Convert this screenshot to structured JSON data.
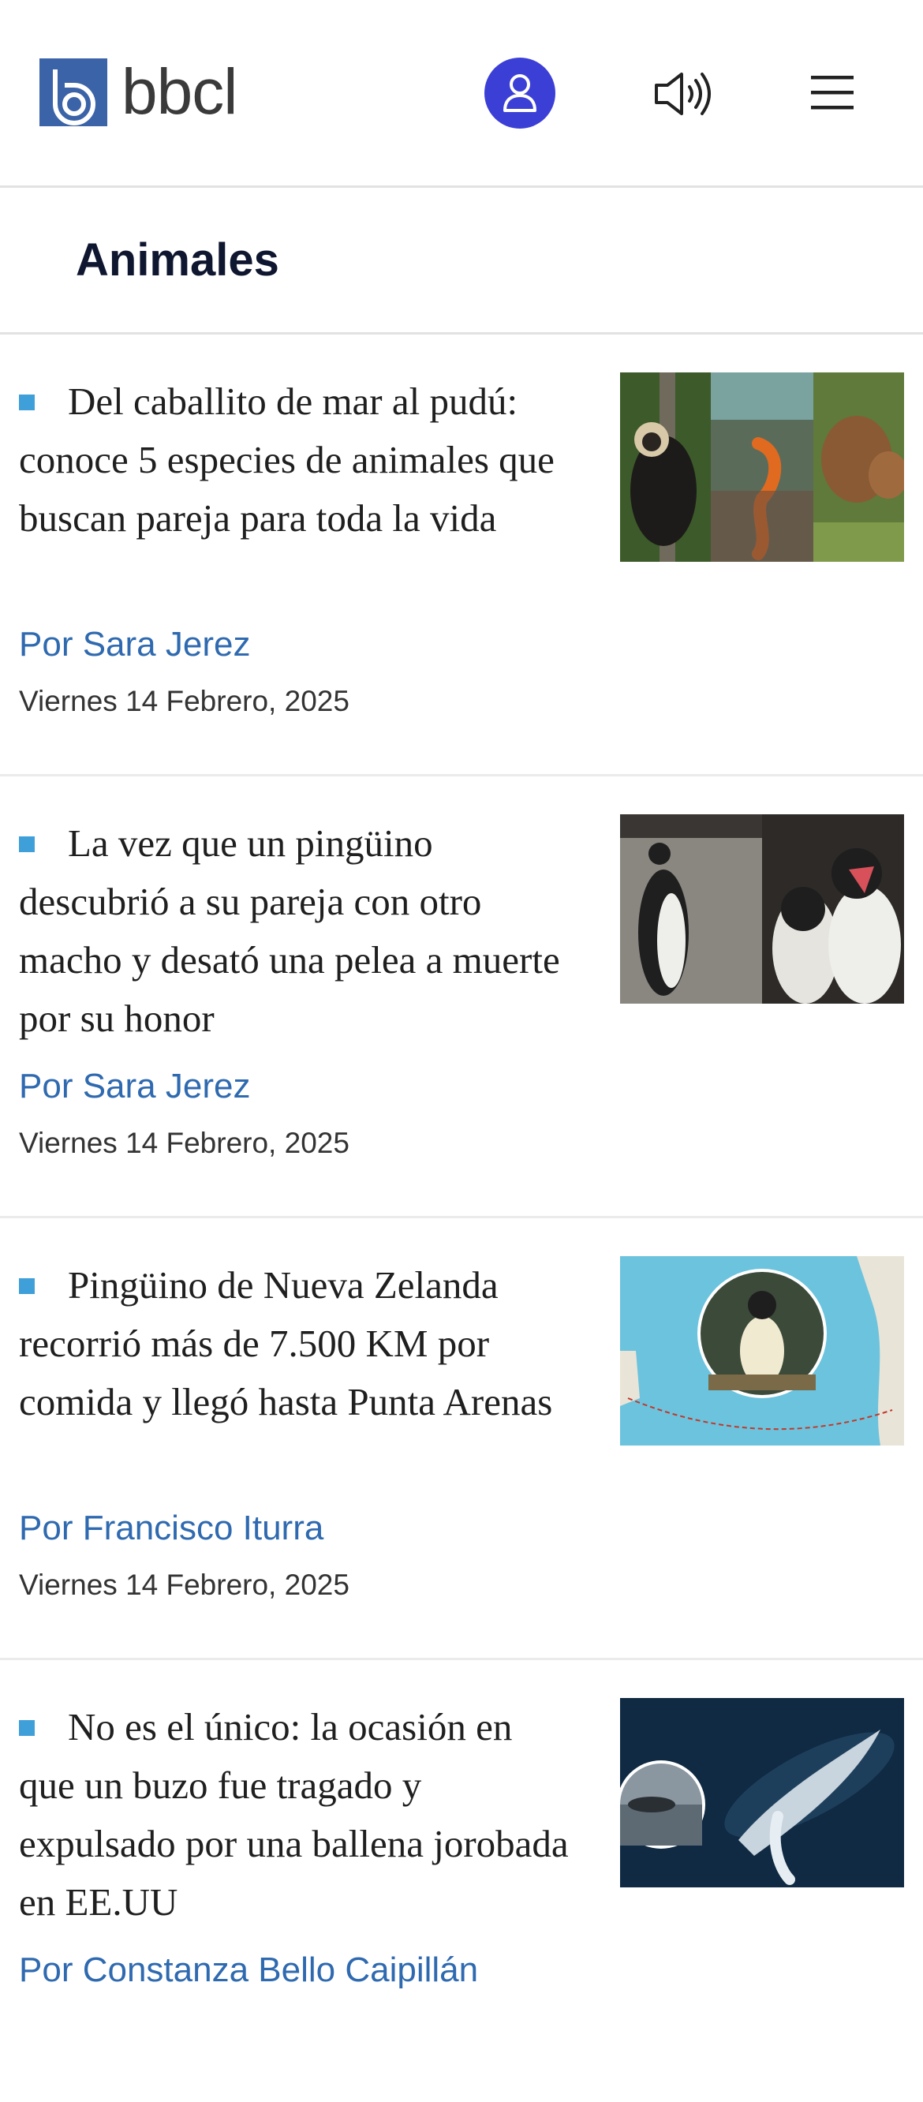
{
  "header": {
    "logo_text": "bbcl",
    "icons": [
      "user-icon",
      "speaker-icon",
      "hamburger-menu-icon"
    ],
    "accent_color": "#3b3fd6",
    "logo_color": "#3b63a8"
  },
  "section": {
    "title": "Animales"
  },
  "articles": [
    {
      "headline": "Del caballito de mar al pudú: conoce 5 especies de animales que buscan pareja para toda la vida",
      "author": "Por Sara Jerez",
      "date": "Viernes 14 Febrero, 2025"
    },
    {
      "headline": "La vez que un pingüino descubrió a su pareja con otro macho y desató una pelea a muerte por su honor",
      "author": "Por Sara Jerez",
      "date": "Viernes 14 Febrero, 2025"
    },
    {
      "headline": "Pingüino de Nueva Zelanda recorrió más de 7.500 KM por comida y llegó hasta Punta Arenas",
      "author": "Por Francisco Iturra",
      "date": "Viernes 14 Febrero, 2025"
    },
    {
      "headline": "No es el único: la ocasión en que un buzo fue tragado y expulsado por una ballena jorobada en EE.UU",
      "author": "Por Constanza Bello Caipillán",
      "date": ""
    }
  ],
  "colors": {
    "bullet": "#3f9fd8",
    "author": "#2f6ab0"
  }
}
